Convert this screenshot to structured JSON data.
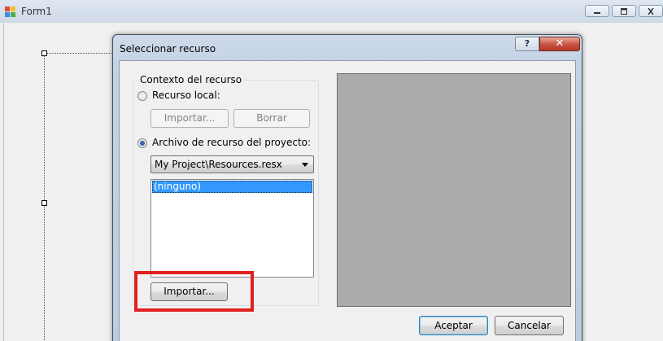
{
  "background_window": {
    "title": "Form1"
  },
  "dialog": {
    "title": "Seleccionar recurso",
    "help_label": "?",
    "close_label": "✕",
    "context_group": {
      "label": "Contexto del recurso",
      "local_resource": {
        "label": "Recurso local:",
        "selected": false,
        "import_label": "Importar...",
        "delete_label": "Borrar"
      },
      "project_resource": {
        "label": "Archivo de recurso del proyecto:",
        "selected": true,
        "file_value": "My Project\\Resources.resx",
        "list_items": [
          "(ninguno)"
        ],
        "import_label": "Importar..."
      }
    },
    "accept_label": "Aceptar",
    "cancel_label": "Cancelar"
  },
  "colors": {
    "selection_blue": "#3399ff",
    "preview_gray": "#ababab",
    "highlight_red": "#e0201e"
  }
}
